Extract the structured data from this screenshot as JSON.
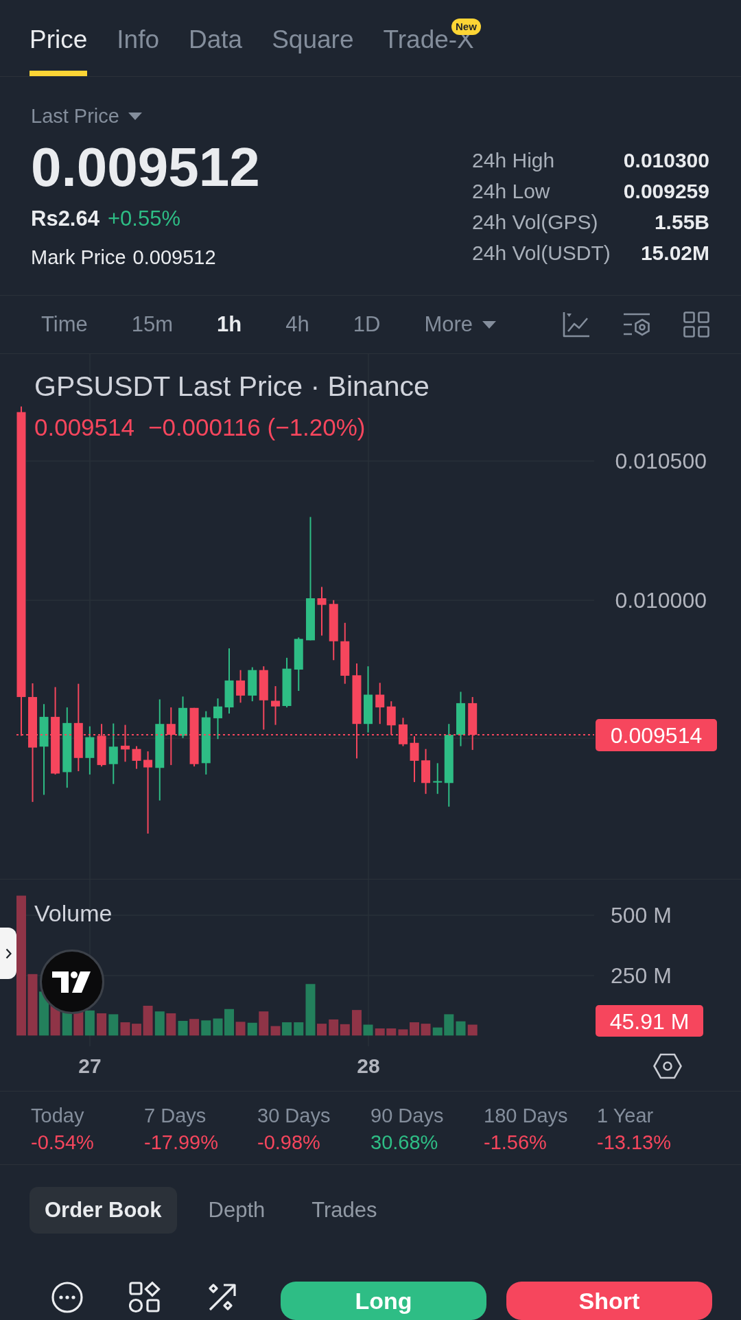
{
  "tabs": [
    {
      "label": "Price",
      "selected": true
    },
    {
      "label": "Info",
      "selected": false
    },
    {
      "label": "Data",
      "selected": false
    },
    {
      "label": "Square",
      "selected": false
    },
    {
      "label": "Trade-X",
      "selected": false,
      "badge": "New"
    }
  ],
  "price_header": {
    "price_type": "Last Price",
    "last_price": "0.009512",
    "fiat_price": "Rs2.64",
    "change": "+0.55%",
    "rising": true,
    "mark_price": {
      "label": "Mark Price",
      "value": "0.009512"
    }
  },
  "stats": [
    {
      "label": "24h High",
      "value": "0.010300"
    },
    {
      "label": "24h Low",
      "value": "0.009259"
    },
    {
      "label": "24h Vol(GPS)",
      "value": "1.55B"
    },
    {
      "label": "24h Vol(USDT)",
      "value": "15.02M"
    }
  ],
  "intervals": [
    {
      "label": "Time",
      "kind": "option",
      "selected": false
    },
    {
      "label": "15m",
      "kind": "option",
      "selected": false
    },
    {
      "label": "1h",
      "kind": "option",
      "selected": true
    },
    {
      "label": "4h",
      "kind": "option",
      "selected": false
    },
    {
      "label": "1D",
      "kind": "option",
      "selected": false
    },
    {
      "label": "More",
      "kind": "dropdown",
      "selected": false
    }
  ],
  "chart": {
    "title": "GPSUSDT Last Price · Binance",
    "legend": {
      "last": "0.009514",
      "change": "−0.000116 (−1.20%)",
      "rising": false
    },
    "price_axis": [
      "0.010500",
      "0.010000"
    ],
    "last_price_tag": "0.009514",
    "volume": {
      "label": "Volume",
      "axis": [
        "500 M",
        "250 M"
      ],
      "last_tag": "45.91 M"
    },
    "dates": [
      "27",
      "28"
    ]
  },
  "performance": [
    {
      "period": "Today",
      "change": "-0.54%",
      "rising": false
    },
    {
      "period": "7 Days",
      "change": "-17.99%",
      "rising": false
    },
    {
      "period": "30 Days",
      "change": "-0.98%",
      "rising": false
    },
    {
      "period": "90 Days",
      "change": "30.68%",
      "rising": true
    },
    {
      "period": "180 Days",
      "change": "-1.56%",
      "rising": false
    },
    {
      "period": "1 Year",
      "change": "-13.13%",
      "rising": false
    }
  ],
  "book_tabs": [
    {
      "label": "Order Book",
      "selected": true
    },
    {
      "label": "Depth",
      "selected": false
    },
    {
      "label": "Trades",
      "selected": false
    }
  ],
  "actions": [
    {
      "label": "Long",
      "kind": "long"
    },
    {
      "label": "Short",
      "kind": "short"
    }
  ]
}
